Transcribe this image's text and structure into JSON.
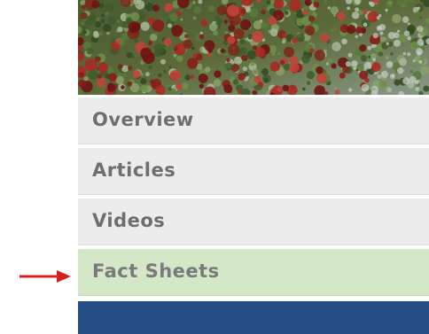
{
  "menu": {
    "items": [
      {
        "label": "Overview",
        "active": false
      },
      {
        "label": "Articles",
        "active": false
      },
      {
        "label": "Videos",
        "active": false
      },
      {
        "label": "Fact Sheets",
        "active": true
      }
    ]
  },
  "colors": {
    "menu_bg": "#ececec",
    "menu_active_bg": "#d4e8c8",
    "menu_text": "#6e6e6e",
    "footer_bar": "#244c85",
    "arrow": "#d62020"
  },
  "icons": {
    "pointer": "arrow-right-icon"
  }
}
